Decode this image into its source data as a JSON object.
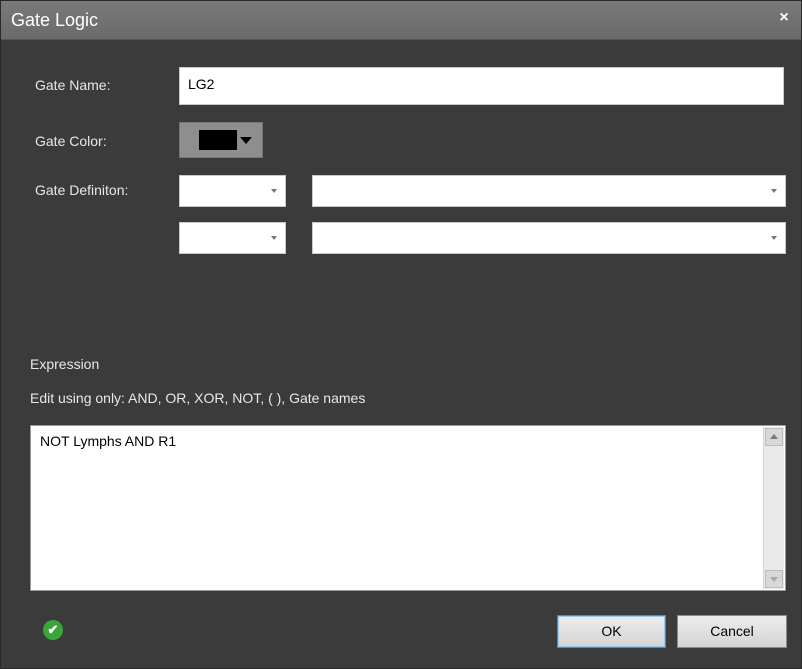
{
  "window": {
    "title": "Gate Logic",
    "close_glyph": "×"
  },
  "form": {
    "gate_name_label": "Gate Name:",
    "gate_name_value": "LG2",
    "gate_color_label": "Gate Color:",
    "gate_color_value": "#000000",
    "gate_definition_label": "Gate Definiton:"
  },
  "expression": {
    "heading": "Expression",
    "hint": "Edit using only: AND, OR, XOR, NOT, ( ), Gate names",
    "value": "NOT Lymphs AND R1"
  },
  "footer": {
    "status_icon": "check-circle-icon",
    "status_glyph": "✔",
    "ok_label": "OK",
    "cancel_label": "Cancel"
  }
}
